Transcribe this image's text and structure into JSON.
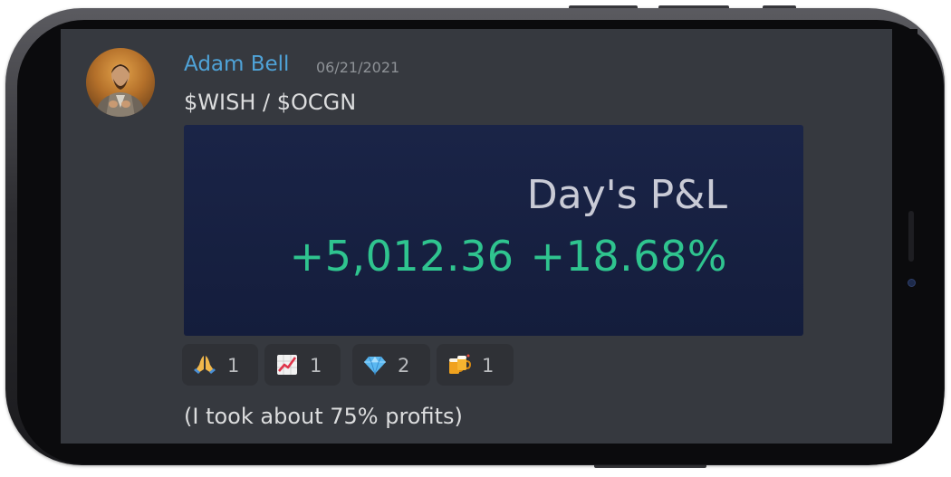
{
  "message": {
    "author": "Adam Bell",
    "timestamp": "06/21/2021",
    "text": "$WISH / $OCGN",
    "footer_text": "(I took about 75% profits)"
  },
  "pnl_card": {
    "label": "Day's P&L",
    "amount": "+5,012.36",
    "percent": "+18.68%",
    "accent_color": "#2fc48f"
  },
  "reactions": [
    {
      "icon": "folded-hands-icon",
      "count": "1"
    },
    {
      "icon": "chart-increasing-icon",
      "count": "1"
    },
    {
      "icon": "gem-icon",
      "count": "2"
    },
    {
      "icon": "beer-mugs-icon",
      "count": "1"
    }
  ],
  "colors": {
    "background": "#36393f",
    "author": "#4fa3d8",
    "text": "#dcddde",
    "timestamp": "#8e9297",
    "card": "#1a2447"
  }
}
